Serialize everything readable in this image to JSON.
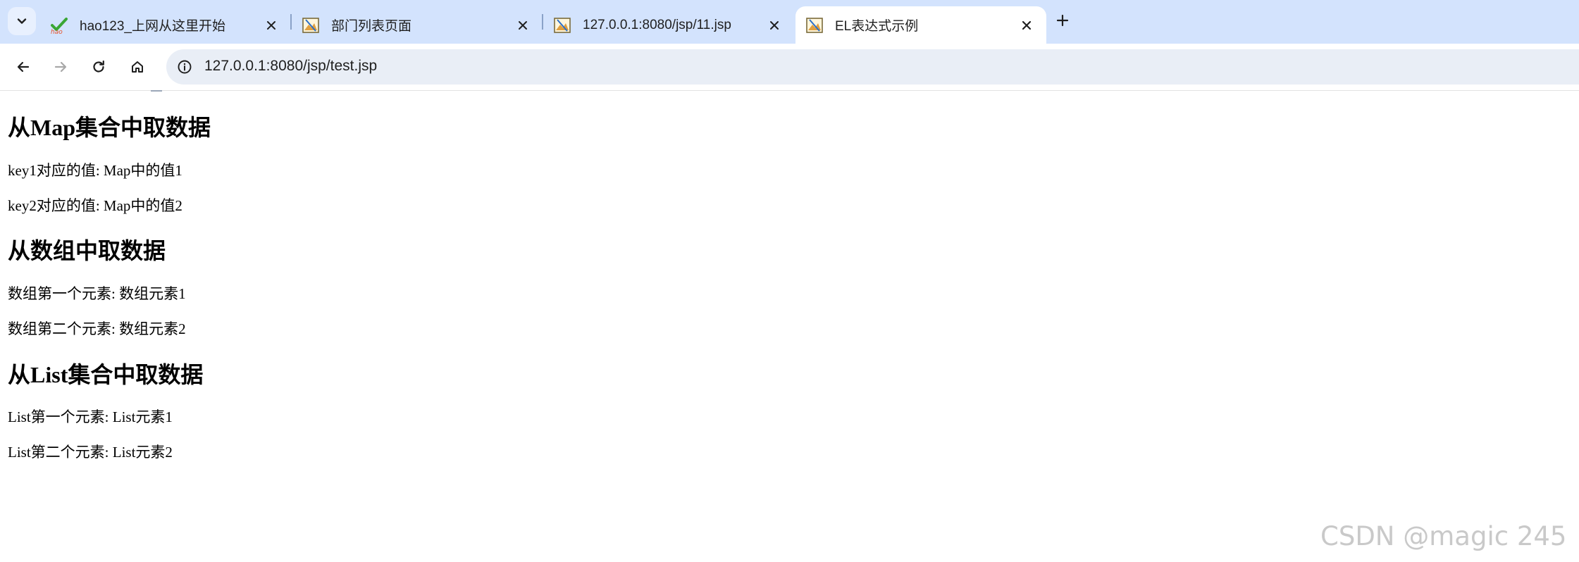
{
  "browser": {
    "tabs": [
      {
        "title": "hao123_上网从这里开始",
        "active": false,
        "favicon": "hao123-icon"
      },
      {
        "title": "部门列表页面",
        "active": false,
        "favicon": "broken-image-icon"
      },
      {
        "title": "127.0.0.1:8080/jsp/11.jsp",
        "active": false,
        "favicon": "broken-image-icon"
      },
      {
        "title": "EL表达式示例",
        "active": true,
        "favicon": "broken-image-icon"
      }
    ],
    "address": "127.0.0.1:8080/jsp/test.jsp",
    "accent": "#d3e3fd"
  },
  "page": {
    "sections": [
      {
        "heading": "从Map集合中取数据",
        "lines": [
          "key1对应的值: Map中的值1",
          "key2对应的值: Map中的值2"
        ]
      },
      {
        "heading": "从数组中取数据",
        "lines": [
          "数组第一个元素: 数组元素1",
          "数组第二个元素: 数组元素2"
        ]
      },
      {
        "heading": "从List集合中取数据",
        "lines": [
          "List第一个元素: List元素1",
          "List第二个元素: List元素2"
        ]
      }
    ]
  },
  "watermark": "CSDN @magic 245"
}
